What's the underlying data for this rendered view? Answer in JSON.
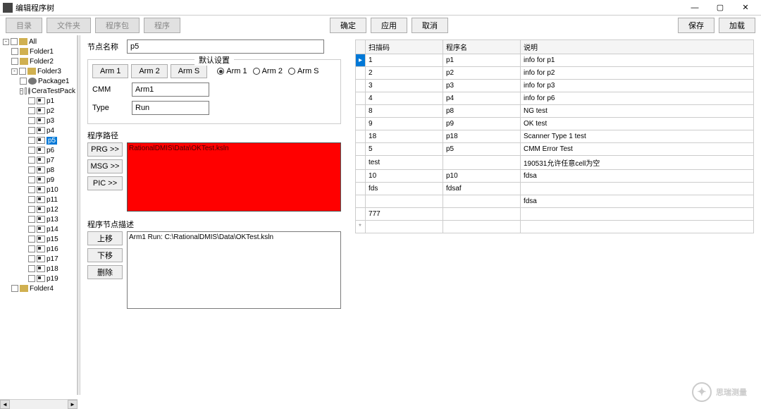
{
  "window": {
    "title": "编辑程序树"
  },
  "toolbar": {
    "btn1": "目录",
    "btn2": "文件夹",
    "btn3": "程序包",
    "btn4": "程序",
    "confirm": "确定",
    "apply": "应用",
    "cancel": "取消",
    "save": "保存",
    "load": "加载"
  },
  "tree": {
    "root": "All",
    "folders": [
      "Folder1",
      "Folder2",
      "Folder3",
      "Folder4"
    ],
    "packages": [
      "Package1",
      "CeraTestPack"
    ],
    "programs": [
      "p1",
      "p2",
      "p3",
      "p4",
      "p5",
      "p6",
      "p7",
      "p8",
      "p9",
      "p10",
      "p11",
      "p12",
      "p13",
      "p14",
      "p15",
      "p16",
      "p17",
      "p18",
      "p19"
    ],
    "selected": "p5"
  },
  "form": {
    "node_name_lbl": "节点名称",
    "node_name_val": "p5",
    "default_group": "默认设置",
    "arm_tabs": [
      "Arm 1",
      "Arm 2",
      "Arm S"
    ],
    "arm_radios": [
      "Arm 1",
      "Arm 2",
      "Arm S"
    ],
    "cmm_lbl": "CMM",
    "cmm_val": "Arm1",
    "type_lbl": "Type",
    "type_val": "Run",
    "path_title": "程序路径",
    "path_val": "RationalDMIS\\Data\\OKTest.ksln",
    "path_btns": [
      "PRG >>",
      "MSG >>",
      "PIC >>"
    ],
    "desc_title": "程序节点描述",
    "desc_val": "Arm1 Run: C:\\RationalDMIS\\Data\\OKTest.ksln",
    "desc_btns": [
      "上移",
      "下移",
      "删除"
    ]
  },
  "table": {
    "headers": [
      "扫描码",
      "程序名",
      "说明"
    ],
    "rows": [
      {
        "scan": "1",
        "prog": "p1",
        "note": "info for p1",
        "sel": true
      },
      {
        "scan": "2",
        "prog": "p2",
        "note": "info for p2"
      },
      {
        "scan": "3",
        "prog": "p3",
        "note": "info for p3"
      },
      {
        "scan": "4",
        "prog": "p4",
        "note": "info for p6"
      },
      {
        "scan": "8",
        "prog": "p8",
        "note": "NG test"
      },
      {
        "scan": "9",
        "prog": "p9",
        "note": "OK test"
      },
      {
        "scan": "18",
        "prog": "p18",
        "note": "Scanner Type 1 test"
      },
      {
        "scan": "5",
        "prog": "p5",
        "note": "CMM Error Test"
      },
      {
        "scan": "test",
        "prog": "",
        "note": "190531允许任意cell为空"
      },
      {
        "scan": "10",
        "prog": "p10",
        "note": "fdsa"
      },
      {
        "scan": "fds",
        "prog": "fdsaf",
        "note": ""
      },
      {
        "scan": "",
        "prog": "",
        "note": "fdsa"
      },
      {
        "scan": "777",
        "prog": "",
        "note": ""
      }
    ],
    "new_marker": "*"
  },
  "watermark": "思瑞测量"
}
